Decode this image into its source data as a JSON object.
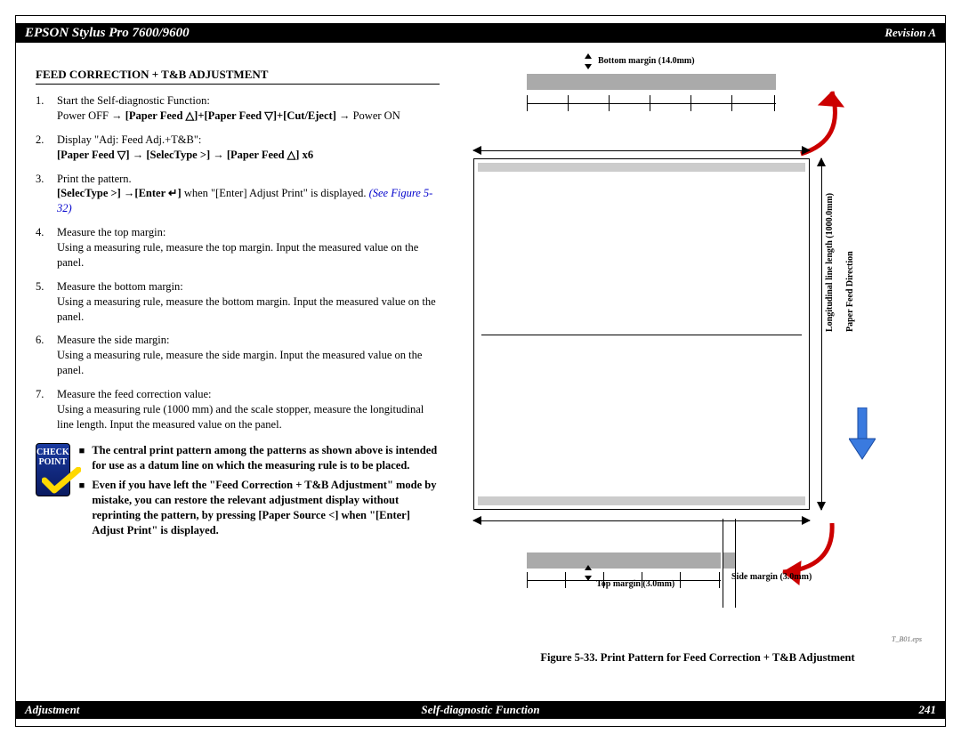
{
  "header": {
    "title": "EPSON Stylus Pro 7600/9600",
    "revision": "Revision A"
  },
  "footer": {
    "left": "Adjustment",
    "center": "Self-diagnostic Function",
    "page": "241"
  },
  "section_title": "FEED CORRECTION + T&B ADJUSTMENT",
  "steps": {
    "s1a": "Start the Self-diagnostic Function:",
    "s1b_pre": "Power OFF → ",
    "s1b_bold": "[Paper Feed △]+[Paper Feed ▽]+[Cut/Eject]",
    "s1b_post": " → Power ON",
    "s2a": "Display \"Adj: Feed Adj.+T&B\":",
    "s2b": "[Paper Feed ▽] → [SelecType >] → [Paper Feed △] x6",
    "s3a": "Print the pattern.",
    "s3b_bold": "[SelecType >] →[Enter ↵]",
    "s3b_post": " when \"[Enter] Adjust Print\" is displayed.  ",
    "seefig": "(See Figure 5-32)",
    "s4a": "Measure the top margin:",
    "s4b": "Using a measuring rule, measure the top margin. Input the measured value on the panel.",
    "s5a": "Measure the bottom margin:",
    "s5b": "Using a measuring rule, measure the bottom margin. Input the measured value on the panel.",
    "s6a": "Measure the side margin:",
    "s6b": "Using a measuring rule, measure the side margin. Input the measured value on the panel.",
    "s7a": "Measure the feed correction value:",
    "s7b": "Using a measuring rule (1000 mm) and the scale stopper, measure the longitudinal line length. Input the measured value on the panel."
  },
  "checkpoint": {
    "title1": "CHECK",
    "title2": "POINT",
    "b1": "The central print pattern among the patterns as shown above is intended for use as a datum line on which the measuring rule is to be placed.",
    "b2": "Even if you have left the \"Feed Correction + T&B Adjustment\" mode by mistake, you can restore the relevant adjustment display without reprinting the pattern, by pressing [Paper Source <] when \"[Enter] Adjust Print\" is displayed."
  },
  "figure": {
    "bottom_margin": "Bottom margin (14.0mm)",
    "top_margin": "Top margin (3.0mm)",
    "side_margin": "Side margin (3.0mm)",
    "long_line": "Longitudinal line length (1000.0mm)",
    "feed_dir": "Paper Feed Direction",
    "eps": "T_B01.eps",
    "caption": "Figure 5-33.  Print Pattern for Feed Correction + T&B Adjustment"
  }
}
